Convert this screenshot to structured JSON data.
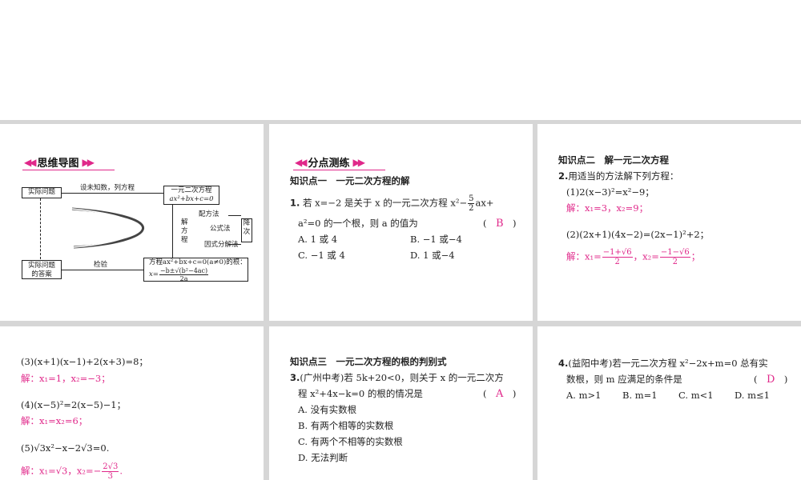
{
  "mindmap": {
    "tag": "思维导图",
    "actual_problem": "实际问题",
    "set_unknown": "设未知数，列方程",
    "equation_title": "一元二次方程",
    "equation_form": "ax²+bx+c=0",
    "methods_label": "解方程",
    "method_completing": "配方法",
    "method_formula": "公式法",
    "method_factor": "因式分解法",
    "reduce_degree": "降次",
    "roots_line1": "方程ax²+bx+c=0(a≠0)的根：",
    "roots_formula_num": "−b±√(b²−4ac)",
    "roots_formula_den": "2a",
    "roots_x": "x=",
    "check": "检验",
    "answer": "实际问题的答案"
  },
  "section1": {
    "tag": "分点测练",
    "kp1_title": "知识点一　一元二次方程的解",
    "q1_num": "1.",
    "q1_line1a": "若 x=−2 是关于 x 的一元二次方程 x²−",
    "q1_frac_num": "5",
    "q1_frac_den": "2",
    "q1_line1b": "ax+",
    "q1_line2": "a²=0 的一个根，则 a 的值为",
    "q1_answer": "B",
    "q1_optA": "A. 1 或 4",
    "q1_optB": "B. −1 或−4",
    "q1_optC": "C. −1 或 4",
    "q1_optD": "D. 1 或−4"
  },
  "section2": {
    "kp2_title": "知识点二　解一元二次方程",
    "q2_num": "2.",
    "q2_text": "用适当的方法解下列方程：",
    "s1_eq": "(1)2(x−3)²=x²−9；",
    "s1_sol": "解：x₁=3，x₂=9；",
    "s2_eq": "(2)(2x+1)(4x−2)=(2x−1)²+2；",
    "s2_sol_prefix": "解：x₁=",
    "s2_x1_num": "−1+√6",
    "s2_x1_den": "2",
    "s2_mid": "，x₂=",
    "s2_x2_num": "−1−√6",
    "s2_x2_den": "2",
    "s2_end": "；"
  },
  "section3": {
    "s3_eq": "(3)(x+1)(x−1)+2(x+3)=8；",
    "s3_sol": "解：x₁=1，x₂=−3；",
    "s4_eq": "(4)(x−5)²=2(x−5)−1；",
    "s4_sol": "解：x₁=x₂=6；",
    "s5_eq": "(5)√3x²−x−2√3=0.",
    "s5_sol_prefix": "解：x₁=√3，x₂=−",
    "s5_num": "2√3",
    "s5_den": "3",
    "s5_end": "."
  },
  "section4": {
    "kp3_title": "知识点三　一元二次方程的根的判别式",
    "q3_num": "3.",
    "q3_line1": "(广州中考)若 5k+20<0，则关于 x 的一元二次方",
    "q3_line2": "程 x²+4x−k=0 的根的情况是",
    "q3_answer": "A",
    "q3_optA": "A. 没有实数根",
    "q3_optB": "B. 有两个相等的实数根",
    "q3_optC": "C. 有两个不相等的实数根",
    "q3_optD": "D. 无法判断"
  },
  "section5": {
    "q4_num": "4.",
    "q4_line1": "(益阳中考)若一元二次方程 x²−2x+m=0 总有实",
    "q4_line2": "数根，则 m 应满足的条件是",
    "q4_answer": "D",
    "q4_optA": "A. m>1",
    "q4_optB": "B. m=1",
    "q4_optC": "C. m<1",
    "q4_optD": "D. m≤1"
  }
}
